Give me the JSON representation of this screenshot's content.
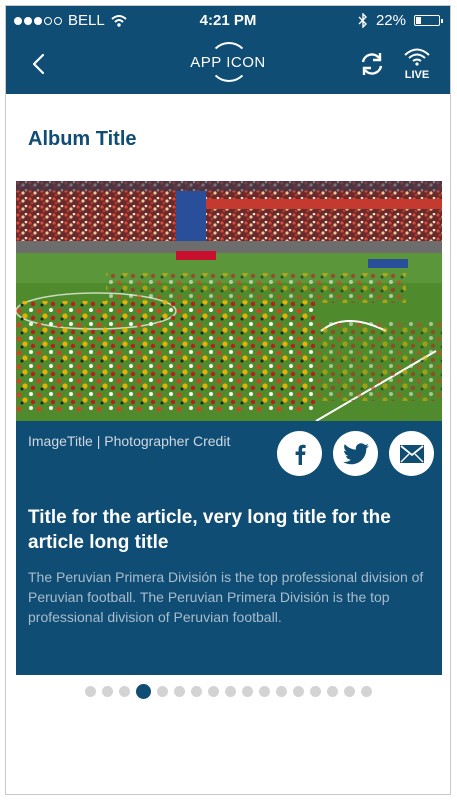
{
  "status_bar": {
    "carrier": "BELL",
    "time": "4:21 PM",
    "battery": "22%",
    "battery_level": 0.22,
    "signal_dots": [
      true,
      true,
      true,
      false,
      false
    ]
  },
  "nav": {
    "back_icon": "chevron-left-icon",
    "app_icon_label": "APP ICON",
    "refresh_icon": "refresh-icon",
    "live_label": "LIVE"
  },
  "album": {
    "title": "Album Title"
  },
  "article": {
    "image_title": "ImageTitle",
    "photographer_credit": "Photographer Credit",
    "separator": "|",
    "title": "Title for the article, very long title for the article long title",
    "body": "The Peruvian Primera División is the top professional division of Peruvian football. The Peruvian Primera División is the top professional division of Peruvian football."
  },
  "share": {
    "icons": [
      "facebook-icon",
      "twitter-icon",
      "email-icon"
    ]
  },
  "pager": {
    "count": 17,
    "active_index": 3
  },
  "colors": {
    "brand": "#0f4d74",
    "pager_inactive": "#d3d3d3"
  }
}
